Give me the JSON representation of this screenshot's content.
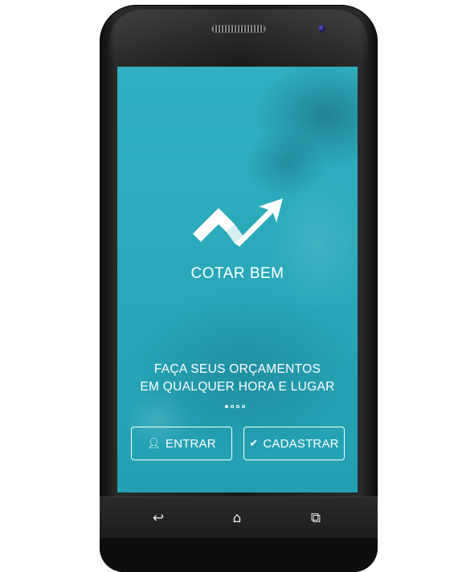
{
  "app": {
    "name": "COTAR BEM",
    "tagline_line1": "FAÇA SEUS ORÇAMENTOS",
    "tagline_line2": "EM QUALQUER HORA E LUGAR"
  },
  "carousel": {
    "pages": 4,
    "active_index": 0
  },
  "buttons": {
    "login_label": "ENTRAR",
    "login_icon": "user-icon",
    "signup_label": "CADASTRAR",
    "signup_icon": "check-icon"
  },
  "device_nav": {
    "back": "back-icon",
    "home": "home-icon",
    "recents": "recents-icon"
  },
  "colors": {
    "screen_bg": "#2aa9ba",
    "text": "#ffffff",
    "device": "#1b1b1b"
  }
}
